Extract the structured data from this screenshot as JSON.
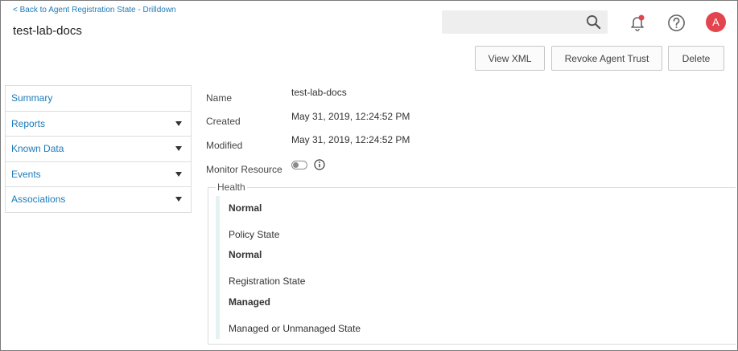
{
  "header": {
    "back_link": "< Back to Agent Registration State - Drilldown",
    "title": "test-lab-docs",
    "avatar_initial": "A",
    "icons": [
      "search-icon",
      "bell-icon",
      "help-icon"
    ],
    "notification_dot_color": "#e3454f"
  },
  "toolbar": {
    "view_xml": "View XML",
    "revoke": "Revoke Agent Trust",
    "delete": "Delete"
  },
  "sidebar": {
    "items": [
      {
        "label": "Summary"
      },
      {
        "label": "Reports"
      },
      {
        "label": "Known Data"
      },
      {
        "label": "Events"
      },
      {
        "label": "Associations"
      }
    ]
  },
  "details": {
    "name_label": "Name",
    "name_value": "test-lab-docs",
    "created_label": "Created",
    "created_value": "May 31, 2019, 12:24:52 PM",
    "modified_label": "Modified",
    "modified_value": "May 31, 2019, 12:24:52 PM",
    "monitor_label": "Monitor Resource",
    "monitor_enabled": false
  },
  "health": {
    "legend": "Health",
    "entries": [
      {
        "value": "Normal",
        "label": "Policy State"
      },
      {
        "value": "Normal",
        "label": "Registration State"
      },
      {
        "value": "Managed",
        "label": "Managed or Unmanaged State"
      }
    ]
  }
}
